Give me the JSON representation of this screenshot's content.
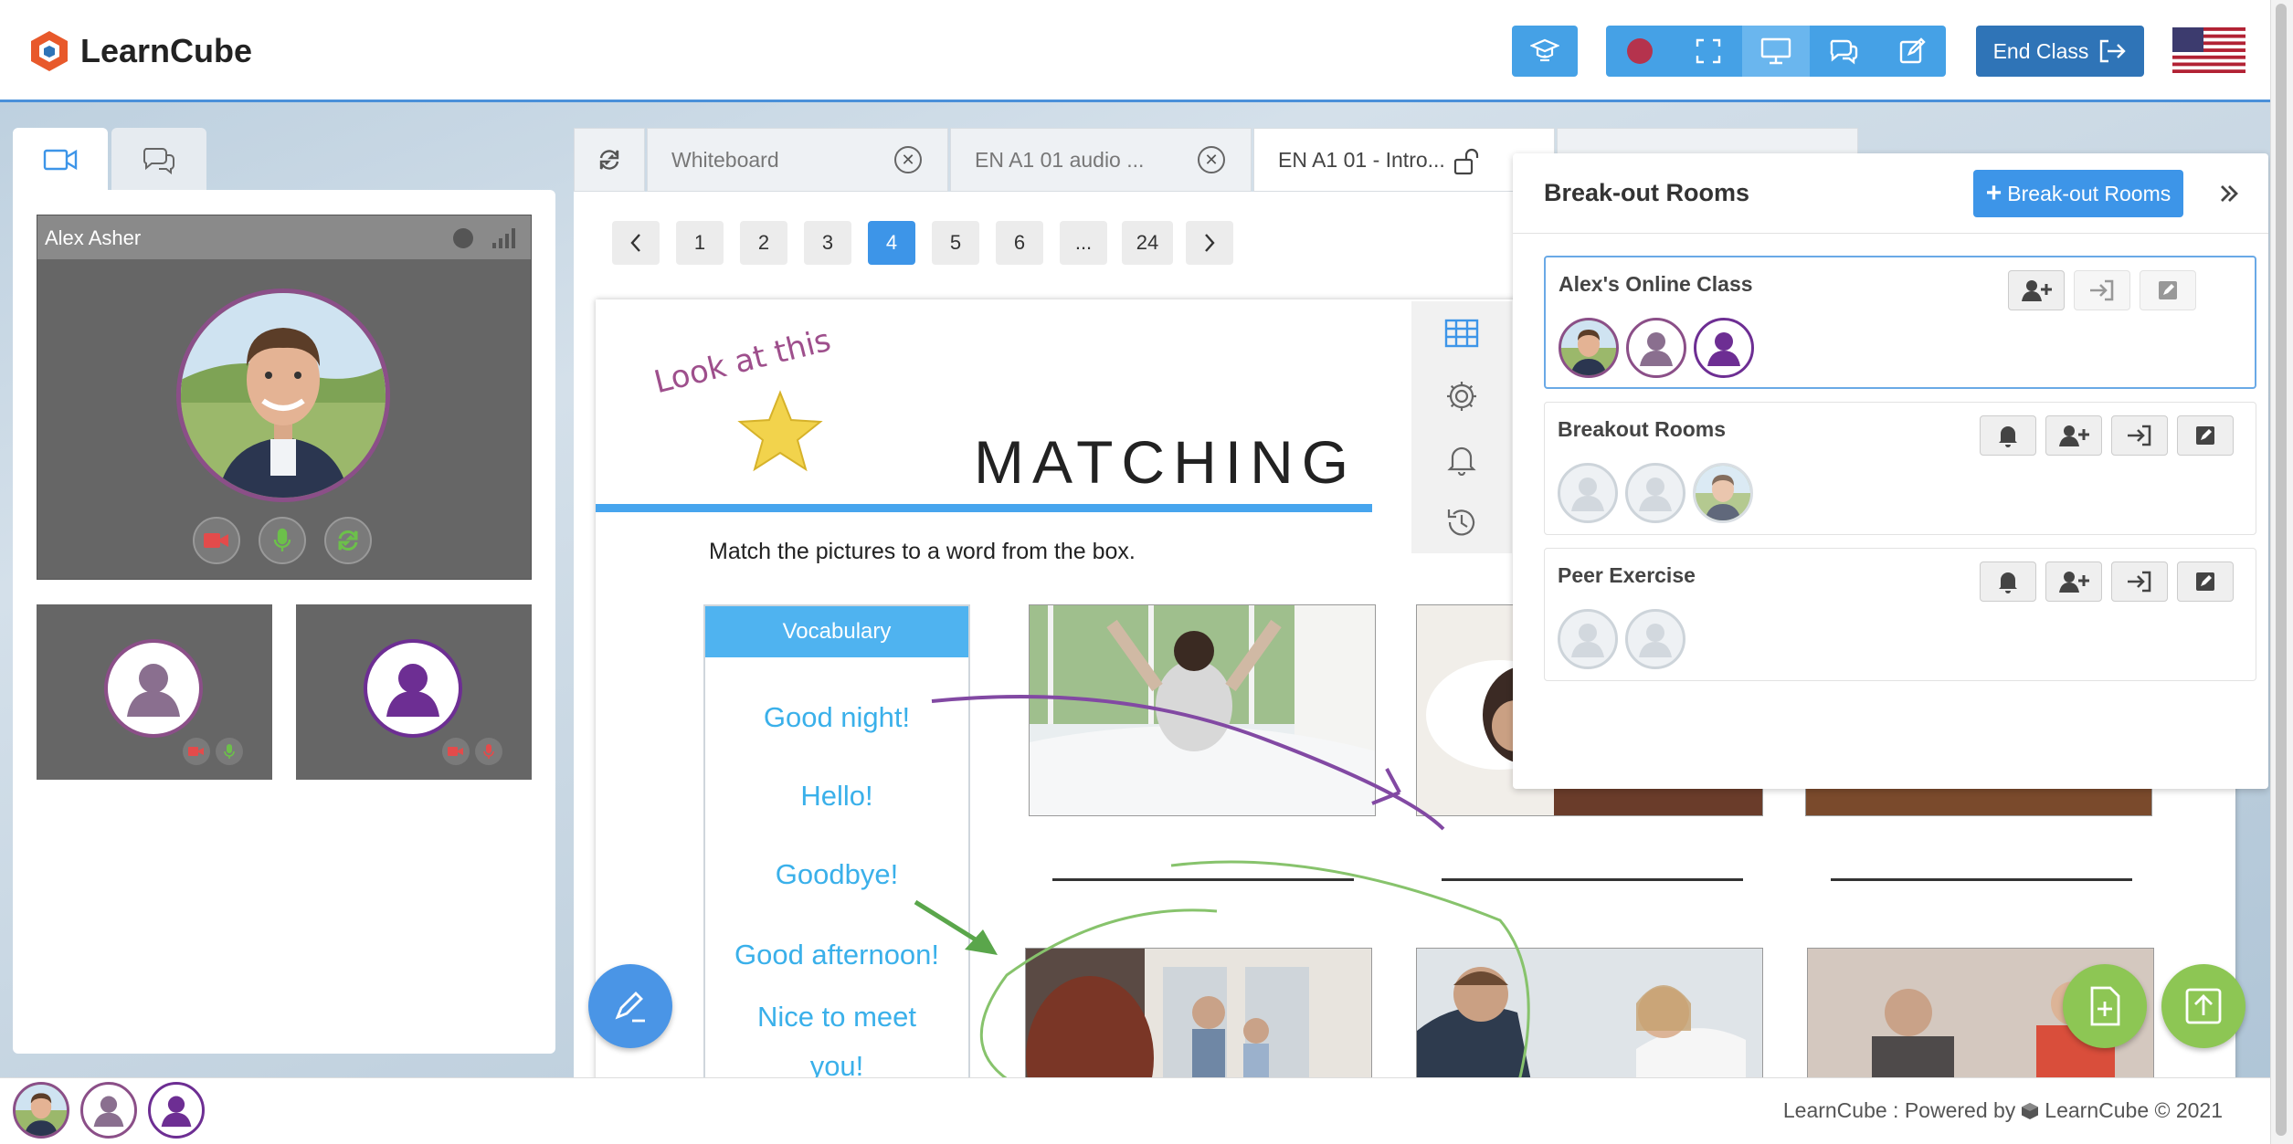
{
  "app": {
    "name": "LearnCube"
  },
  "toolbar": {
    "end_class_label": "End Class"
  },
  "left_panel": {
    "main_video_name": "Alex Asher"
  },
  "tabs": [
    {
      "label": "Whiteboard"
    },
    {
      "label": "EN A1 01 audio ..."
    },
    {
      "label": "EN A1 01 - Intro..."
    }
  ],
  "pager": {
    "pages": [
      "1",
      "2",
      "3",
      "4",
      "5",
      "6",
      "...",
      "24"
    ],
    "current": "4"
  },
  "slide": {
    "annotation": "Look at this",
    "title": "MATCHING",
    "instruction": "Match the pictures to a word from the box.",
    "vocab_header": "Vocabulary",
    "vocab": [
      "Good night!",
      "Hello!",
      "Goodbye!",
      "Good afternoon!",
      "Nice to meet",
      "you!"
    ]
  },
  "breakout": {
    "title": "Break-out Rooms",
    "add_label": "Break-out Rooms",
    "rooms": [
      {
        "name": "Alex's Online Class"
      },
      {
        "name": "Breakout Rooms"
      },
      {
        "name": "Peer Exercise"
      }
    ]
  },
  "footer": {
    "text": "LearnCube : Powered by",
    "brand_suffix": "LearnCube © 2021"
  },
  "colors": {
    "accent": "#45a1e6",
    "primary_dark": "#2f74b7",
    "record_red": "#b5334d",
    "vocab_blue": "#3ab0ea",
    "purple": "#7b3aa0",
    "green": "#8dc654"
  }
}
